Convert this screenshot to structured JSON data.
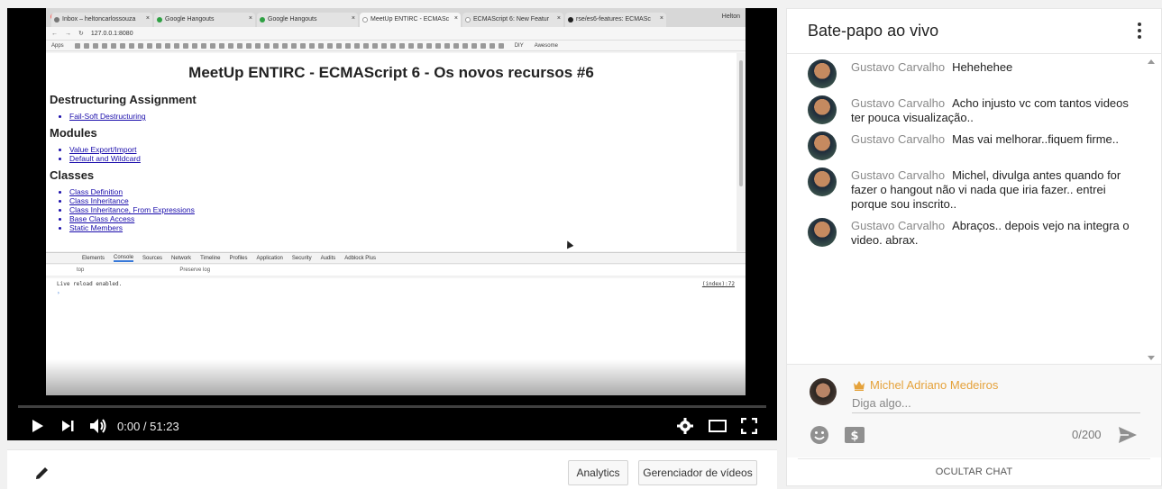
{
  "browser": {
    "tabs": [
      {
        "label": "Inbox – heltoncarlossouza",
        "active": false
      },
      {
        "label": "Google Hangouts",
        "active": false
      },
      {
        "label": "Google Hangouts",
        "active": false
      },
      {
        "label": "MeetUp ENTIRC - ECMASc",
        "active": true
      },
      {
        "label": "ECMAScript 6: New Featur",
        "active": false
      },
      {
        "label": "rse/es6-features: ECMASc",
        "active": false
      }
    ],
    "profile_name": "Helton",
    "url": "127.0.0.1:8080",
    "bookmarks": {
      "apps": "Apps",
      "diy": "DIY",
      "awesome": "Awesome"
    }
  },
  "page": {
    "title": "MeetUp ENTIRC - ECMAScript 6 - Os novos recursos #6",
    "sections": [
      {
        "heading": "Destructuring Assignment",
        "links": [
          "Fail-Soft Destructuring"
        ]
      },
      {
        "heading": "Modules",
        "links": [
          "Value Export/Import",
          "Default and Wildcard"
        ]
      },
      {
        "heading": "Classes",
        "links": [
          "Class Definition",
          "Class Inheritance",
          "Class Inheritance, From Expressions",
          "Base Class Access",
          "Static Members"
        ]
      }
    ]
  },
  "devtools": {
    "tabs": [
      "Elements",
      "Console",
      "Sources",
      "Network",
      "Timeline",
      "Profiles",
      "Application",
      "Security",
      "Audits",
      "Adblock Plus"
    ],
    "active_tab": "Console",
    "context": "top",
    "preserve_log": "Preserve log",
    "log_message": "Live reload enabled.",
    "log_ref": "(index):72",
    "prompt": "›"
  },
  "player": {
    "time": "0:00 / 51:23",
    "progress": 0.0
  },
  "below_player": {
    "analytics_label": "Analytics",
    "video_manager_label": "Gerenciador de vídeos"
  },
  "chat": {
    "title": "Bate-papo ao vivo",
    "messages": [
      {
        "author": "Gustavo Carvalho",
        "text": "Hehehehee"
      },
      {
        "author": "Gustavo Carvalho",
        "text": "Acho injusto vc com tantos videos ter pouca visualização.."
      },
      {
        "author": "Gustavo Carvalho",
        "text": "Mas vai melhorar..fiquem firme.."
      },
      {
        "author": "Gustavo Carvalho",
        "text": "Michel, divulga antes quando for fazer o hangout não vi nada que iria fazer.. entrei porque sou inscrito.."
      },
      {
        "author": "Gustavo Carvalho",
        "text": "Abraços.. depois vejo na integra o video. abrax."
      }
    ],
    "composer": {
      "user_name": "Michel Adriano Medeiros",
      "placeholder": "Diga algo...",
      "counter": "0/200"
    },
    "hide_label": "OCULTAR CHAT"
  },
  "colors": {
    "owner_name": "#e5a23b",
    "link": "#1a0dab",
    "player_bg": "#000000"
  }
}
